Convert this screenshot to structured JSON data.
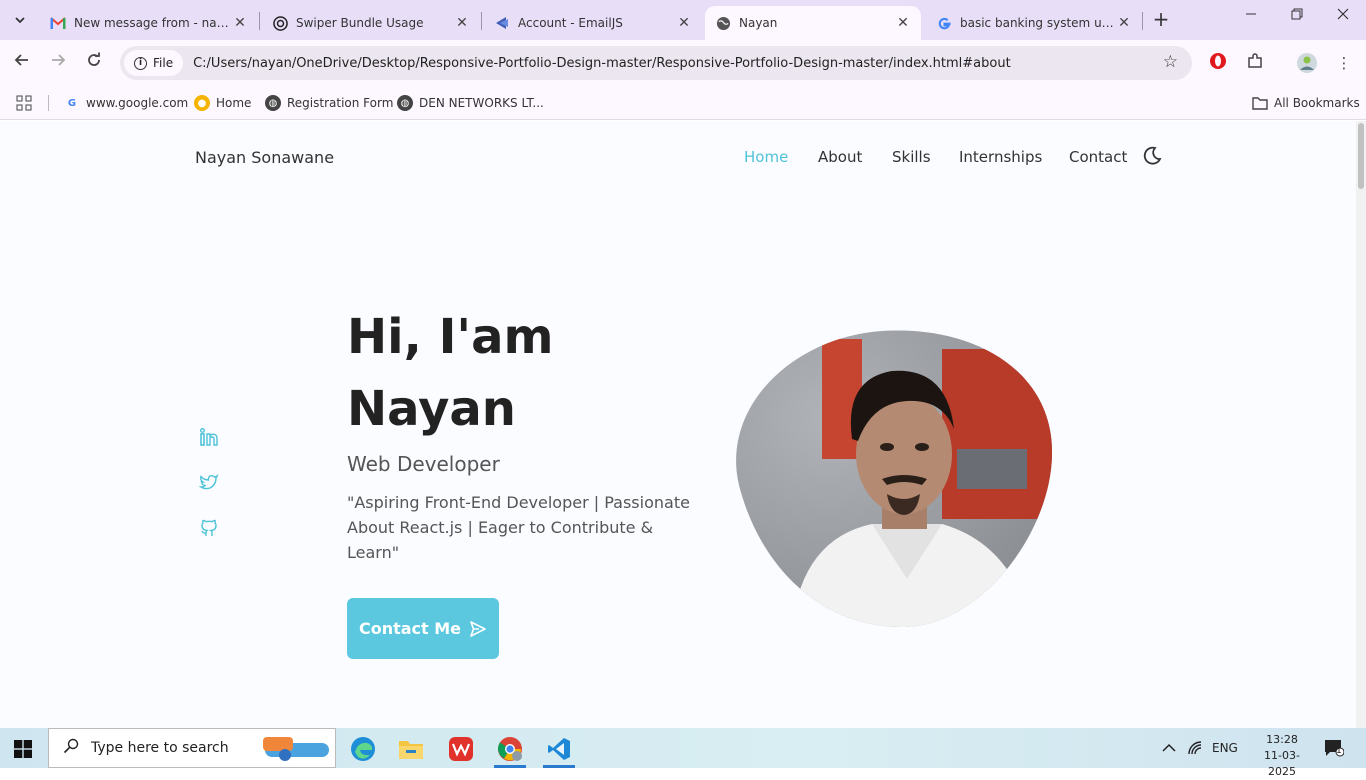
{
  "tabs": [
    {
      "label": "New message from - nayans",
      "icon": "gmail-icon"
    },
    {
      "label": "Swiper Bundle Usage",
      "icon": "openai-icon"
    },
    {
      "label": "Account - EmailJS",
      "icon": "emailjs-icon"
    },
    {
      "label": "Nayan",
      "icon": "globe-icon",
      "active": true
    },
    {
      "label": "basic banking system using",
      "icon": "google-icon"
    }
  ],
  "address": {
    "scheme_label": "File",
    "url": "C:/Users/nayan/OneDrive/Desktop/Responsive-Portfolio-Design-master/Responsive-Portfolio-Design-master/index.html#about"
  },
  "bookmarks": {
    "items": [
      {
        "label": "www.google.com"
      },
      {
        "label": "Home"
      },
      {
        "label": "Registration Form"
      },
      {
        "label": "DEN NETWORKS LT..."
      }
    ],
    "all_label": "All Bookmarks"
  },
  "site": {
    "logo": "Nayan Sonawane",
    "nav": [
      "Home",
      "About",
      "Skills",
      "Internships",
      "Contact"
    ],
    "accent": "#5bc8df",
    "hero": {
      "line1": "Hi, I'am",
      "line2": "Nayan",
      "subtitle": "Web Developer",
      "description": "\"Aspiring Front-End Developer | Passionate About React.js | Eager to Contribute & Learn\"",
      "cta": "Contact Me"
    },
    "social": [
      "linkedin-icon",
      "twitter-icon",
      "github-icon"
    ]
  },
  "taskbar": {
    "search_placeholder": "Type here to search",
    "lang": "ENG",
    "time": "13:28",
    "date": "11-03-2025",
    "notifications": "1"
  }
}
